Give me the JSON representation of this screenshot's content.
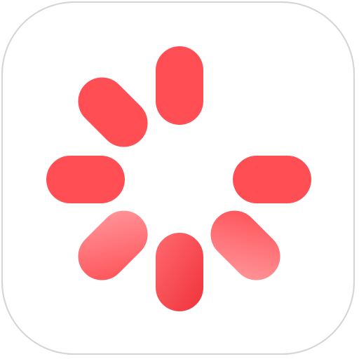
{
  "app_icon": {
    "name": "loading-spinner-app-icon",
    "tile_color": "#ffffff",
    "border_color": "#d4d4d4",
    "spinner": {
      "icon": "loading-spinner-icon",
      "accent_color": "#ff4f55",
      "highlight_color": "#ff9a9e",
      "shade_color": "#f0323a",
      "segment_count": 8,
      "visible_segments": [
        "top",
        "top-left",
        "left",
        "right",
        "bottom-left",
        "bottom",
        "bottom-right"
      ],
      "missing_segments": [
        "top-right"
      ]
    }
  }
}
